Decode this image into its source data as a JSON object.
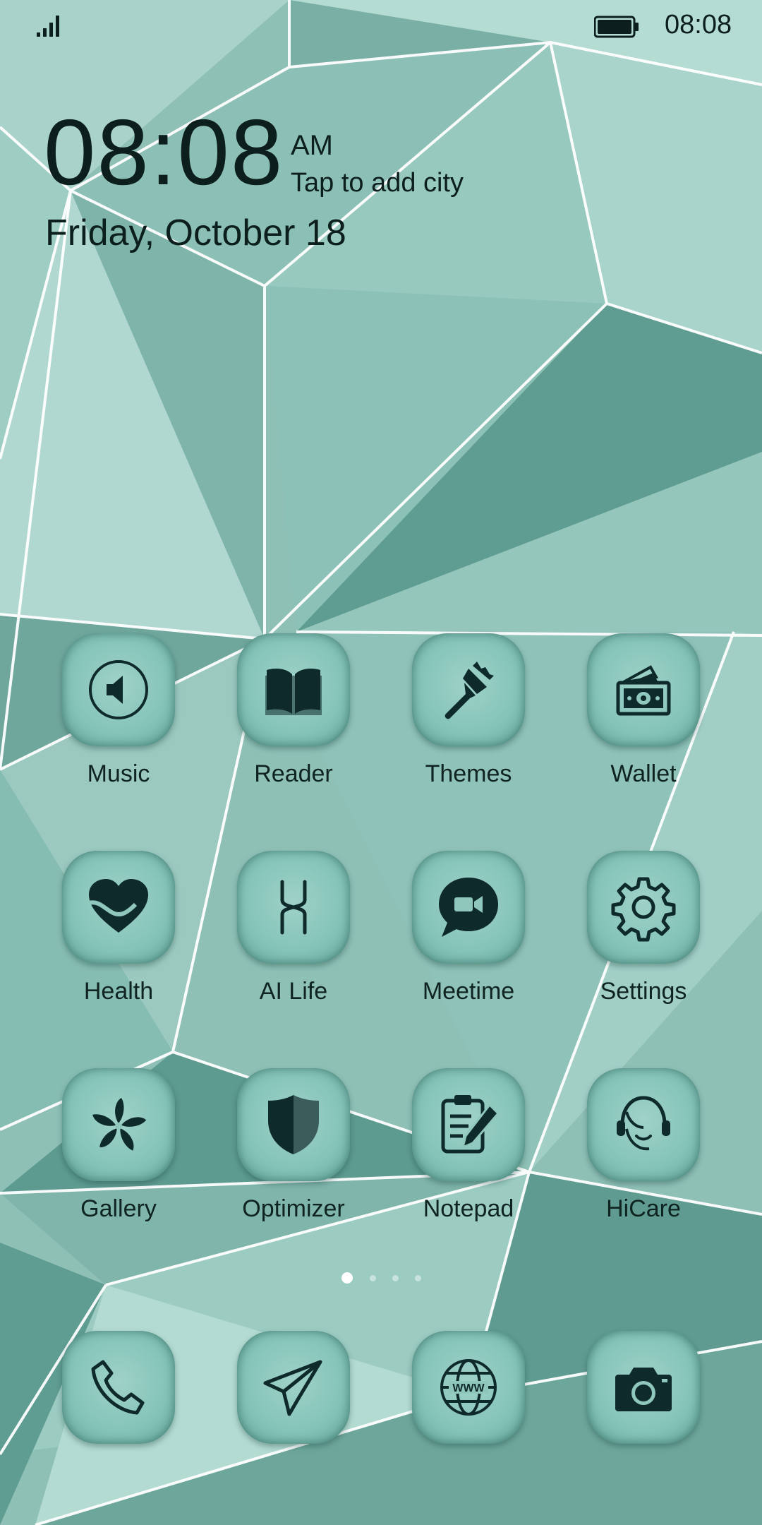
{
  "status_bar": {
    "time": "08:08"
  },
  "clock_widget": {
    "time": "08:08",
    "ampm": "AM",
    "city_prompt": "Tap to add city",
    "date": "Friday, October 18"
  },
  "apps": [
    {
      "label": "Music",
      "icon": "speaker-icon"
    },
    {
      "label": "Reader",
      "icon": "book-icon"
    },
    {
      "label": "Themes",
      "icon": "paintbrush-icon"
    },
    {
      "label": "Wallet",
      "icon": "wallet-icon"
    },
    {
      "label": "Health",
      "icon": "heart-icon"
    },
    {
      "label": "AI Life",
      "icon": "ai-life-icon"
    },
    {
      "label": "Meetime",
      "icon": "video-chat-icon"
    },
    {
      "label": "Settings",
      "icon": "gear-icon"
    },
    {
      "label": "Gallery",
      "icon": "flower-icon"
    },
    {
      "label": "Optimizer",
      "icon": "shield-icon"
    },
    {
      "label": "Notepad",
      "icon": "clipboard-pencil-icon"
    },
    {
      "label": "HiCare",
      "icon": "headset-icon"
    }
  ],
  "page_indicator": {
    "count": 4,
    "active": 1
  },
  "dock": [
    {
      "icon": "phone-icon"
    },
    {
      "icon": "paper-plane-icon"
    },
    {
      "icon": "globe-icon"
    },
    {
      "icon": "camera-icon"
    }
  ],
  "colors": {
    "tile": "#84c3b8",
    "icon": "#0f2a2a",
    "wallpaper": "#8fc0b6"
  }
}
